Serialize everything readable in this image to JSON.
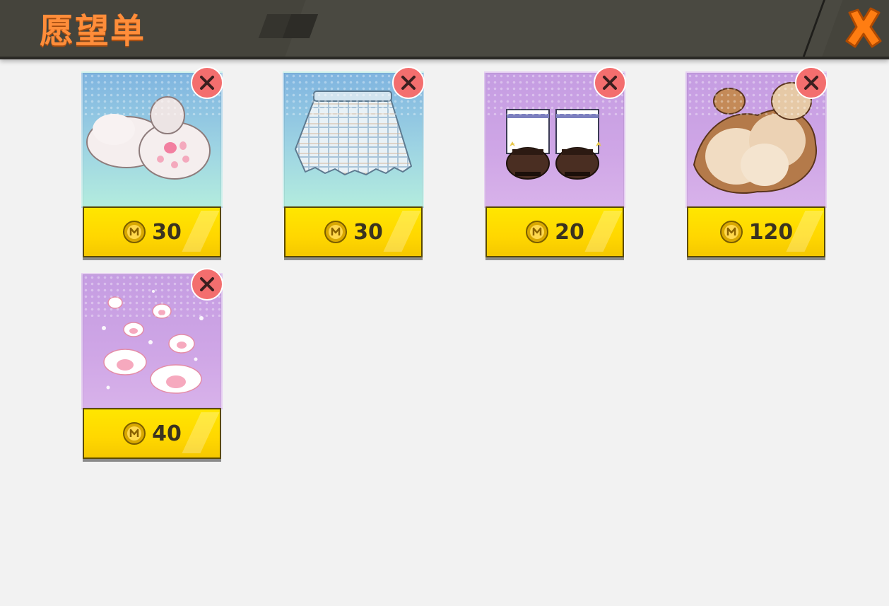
{
  "header": {
    "title": "愿望单"
  },
  "colors": {
    "header_bg": "#45443c",
    "title": "#ff8d3a",
    "close": "#ff7d12",
    "price_button": "#ffd700",
    "remove": "#f36e6e"
  },
  "wishlist": [
    {
      "item": "fluffy paw gloves",
      "price": "30",
      "bg": "blue"
    },
    {
      "item": "plaid pleated skirt",
      "price": "30",
      "bg": "blue"
    },
    {
      "item": "white socks with loafers",
      "price": "20",
      "bg": "purple"
    },
    {
      "item": "fluffy fox tails",
      "price": "120",
      "bg": "purple"
    },
    {
      "item": "paw print effect",
      "price": "40",
      "bg": "purple"
    }
  ],
  "icons": {
    "close": "close-icon",
    "remove": "remove-x-icon",
    "currency": "m-coin-icon"
  }
}
